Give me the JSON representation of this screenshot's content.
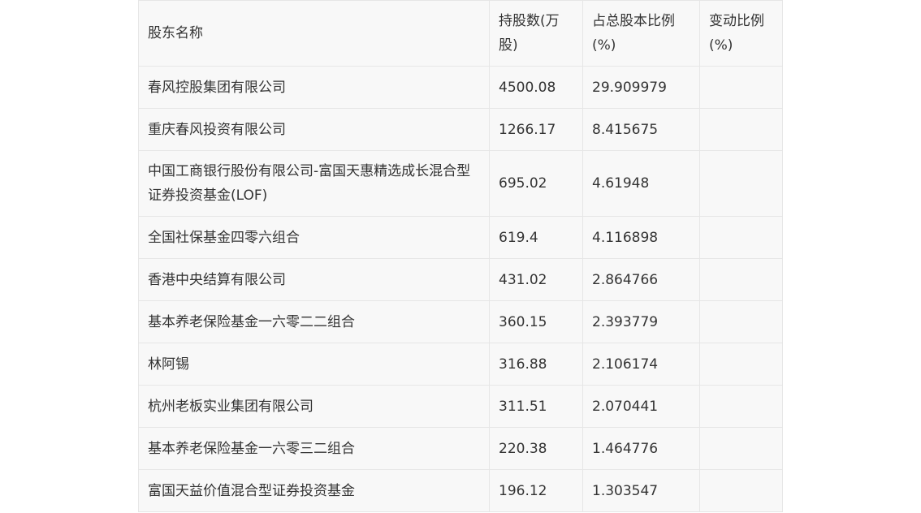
{
  "table": {
    "headers": [
      "股东名称",
      "持股数(万股)",
      "占总股本比例(%)",
      "变动比例(%)"
    ],
    "rows": [
      {
        "name": "春风控股集团有限公司",
        "shares": "4500.08",
        "ratio": "29.909979",
        "change": ""
      },
      {
        "name": "重庆春风投资有限公司",
        "shares": "1266.17",
        "ratio": "8.415675",
        "change": ""
      },
      {
        "name": "中国工商银行股份有限公司-富国天惠精选成长混合型证券投资基金(LOF)",
        "shares": "695.02",
        "ratio": "4.61948",
        "change": ""
      },
      {
        "name": "全国社保基金四零六组合",
        "shares": "619.4",
        "ratio": "4.116898",
        "change": ""
      },
      {
        "name": "香港中央结算有限公司",
        "shares": "431.02",
        "ratio": "2.864766",
        "change": ""
      },
      {
        "name": "基本养老保险基金一六零二二组合",
        "shares": "360.15",
        "ratio": "2.393779",
        "change": ""
      },
      {
        "name": "林阿锡",
        "shares": "316.88",
        "ratio": "2.106174",
        "change": ""
      },
      {
        "name": "杭州老板实业集团有限公司",
        "shares": "311.51",
        "ratio": "2.070441",
        "change": ""
      },
      {
        "name": "基本养老保险基金一六零三二组合",
        "shares": "220.38",
        "ratio": "1.464776",
        "change": ""
      },
      {
        "name": "富国天益价值混合型证券投资基金",
        "shares": "196.12",
        "ratio": "1.303547",
        "change": ""
      }
    ]
  }
}
